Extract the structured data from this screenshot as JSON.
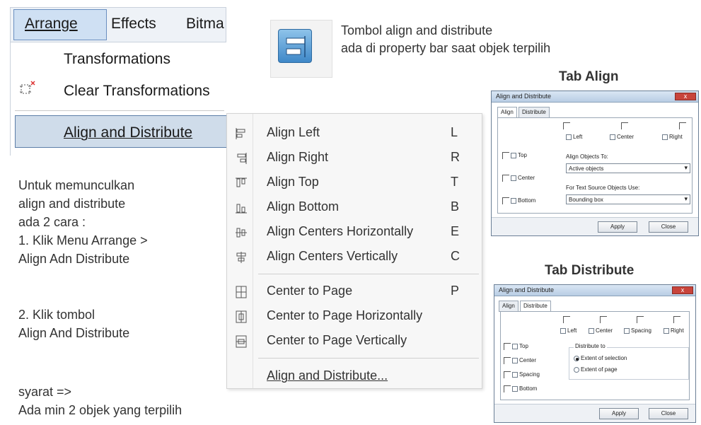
{
  "menubar": {
    "items": [
      "Arrange",
      "Effects",
      "Bitma"
    ]
  },
  "arrange_menu": {
    "items": [
      "Transformations",
      "Clear Transformations",
      "Align and Distribute"
    ]
  },
  "left_text": {
    "intro": [
      "Untuk memunculkan",
      "align and distribute",
      "ada 2 cara :",
      "1. Klik Menu  Arrange >",
      "Align Adn Distribute"
    ],
    "step2": [
      "2. Klik tombol",
      "Align And Distribute"
    ],
    "requirement": [
      "syarat =>",
      "Ada min 2 objek yang terpilih"
    ]
  },
  "submenu": {
    "items": [
      {
        "label": "Align Left",
        "key": "L",
        "icon": "align-left-icon"
      },
      {
        "label": "Align Right",
        "key": "R",
        "icon": "align-right-icon"
      },
      {
        "label": "Align Top",
        "key": "T",
        "icon": "align-top-icon"
      },
      {
        "label": "Align Bottom",
        "key": "B",
        "icon": "align-bottom-icon"
      },
      {
        "label": "Align Centers Horizontally",
        "key": "E",
        "icon": "align-center-h-icon"
      },
      {
        "label": "Align Centers Vertically",
        "key": "C",
        "icon": "align-center-v-icon"
      },
      {
        "label": "Center to Page",
        "key": "P",
        "icon": "center-page-icon"
      },
      {
        "label": "Center to Page Horizontally",
        "key": "",
        "icon": "center-page-h-icon"
      },
      {
        "label": "Center to Page Vertically",
        "key": "",
        "icon": "center-page-v-icon"
      },
      {
        "label": "Align and Distribute...",
        "key": "",
        "icon": ""
      }
    ]
  },
  "property_note": {
    "line1": "Tombol align and distribute",
    "line2": "ada di property bar saat objek terpilih"
  },
  "tab_align": {
    "heading": "Tab Align",
    "title": "Align and Distribute",
    "close": "x",
    "tabs": [
      "Align",
      "Distribute"
    ],
    "checks_top": [
      "Left",
      "Center",
      "Right"
    ],
    "checks_side": [
      "Top",
      "Center",
      "Bottom"
    ],
    "objects_label": "Align Objects To:",
    "objects_value": "Active objects",
    "source_label": "For Text Source Objects Use:",
    "source_value": "Bounding box",
    "apply": "Apply",
    "close_btn": "Close"
  },
  "tab_distribute": {
    "heading": "Tab Distribute",
    "title": "Align and Distribute",
    "close": "x",
    "tabs": [
      "Align",
      "Distribute"
    ],
    "checks_top": [
      "Left",
      "Center",
      "Spacing",
      "Right"
    ],
    "checks_side": [
      "Top",
      "Center",
      "Spacing",
      "Bottom"
    ],
    "distribute_label": "Distribute to",
    "radio1": "Extent of selection",
    "radio2": "Extent of page",
    "apply": "Apply",
    "close_btn": "Close"
  },
  "colors": {
    "menu_highlight": "#cfdcea",
    "dialog_title": "#b9cde4",
    "close_red": "#c8443b",
    "button_blue": "#3f88c8"
  }
}
